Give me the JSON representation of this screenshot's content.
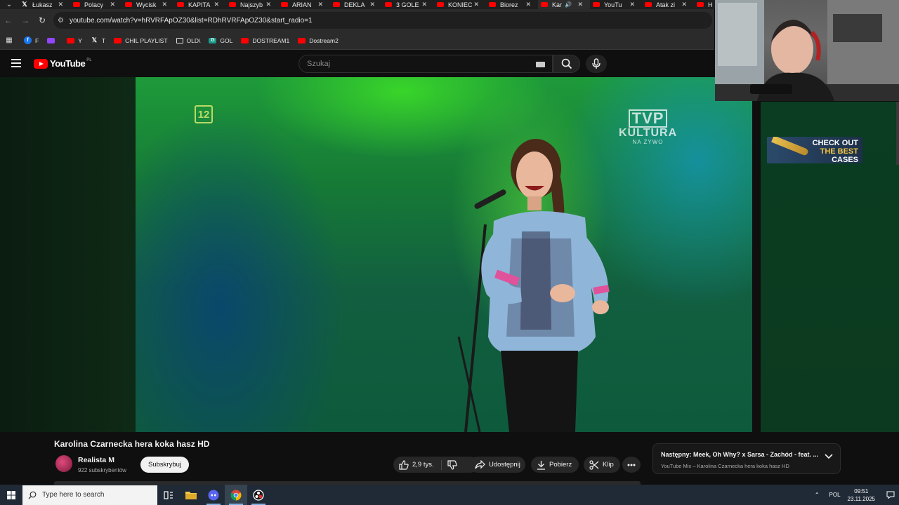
{
  "browser": {
    "tabs": [
      {
        "label": "Łukasz",
        "icon": "x-icon"
      },
      {
        "label": "Polacy",
        "icon": "youtube-icon"
      },
      {
        "label": "Wycisk",
        "icon": "youtube-icon"
      },
      {
        "label": "KAPITA",
        "icon": "youtube-icon"
      },
      {
        "label": "Najszyb",
        "icon": "youtube-icon"
      },
      {
        "label": "ARIAN",
        "icon": "youtube-icon"
      },
      {
        "label": "DEKLA",
        "icon": "youtube-icon"
      },
      {
        "label": "3 GOLE",
        "icon": "youtube-icon"
      },
      {
        "label": "KONIEC",
        "icon": "youtube-icon"
      },
      {
        "label": "Biorez",
        "icon": "youtube-icon"
      },
      {
        "label": "Kar",
        "icon": "youtube-icon",
        "active": true,
        "audio": true
      },
      {
        "label": "YouTu",
        "icon": "youtube-icon"
      },
      {
        "label": "Atak zi",
        "icon": "youtube-icon"
      },
      {
        "label": "H",
        "icon": "youtube-icon"
      }
    ],
    "url": "youtube.com/watch?v=hRVRFApOZ30&list=RDhRVRFApOZ30&start_radio=1",
    "bookmarks": [
      {
        "label": "F",
        "icon": "facebook-icon"
      },
      {
        "label": "",
        "icon": "twitch-icon"
      },
      {
        "label": "Y",
        "icon": "youtube-icon"
      },
      {
        "label": "T",
        "icon": "x-icon"
      },
      {
        "label": "CHIL PLAYLIST",
        "icon": "youtube-icon"
      },
      {
        "label": "OLD\\",
        "icon": "folder-icon"
      },
      {
        "label": "GOL",
        "icon": "g-icon"
      },
      {
        "label": "DOSTREAM1",
        "icon": "youtube-icon"
      },
      {
        "label": "Dostream2",
        "icon": "youtube-icon"
      }
    ]
  },
  "youtube": {
    "logo_text": "YouTube",
    "country_code": "PL",
    "search_placeholder": "Szukaj"
  },
  "video": {
    "overlay_channel_number": "12",
    "broadcaster_logo": "TVP",
    "broadcaster_name": "KULTURA",
    "broadcaster_live": "NA ŻYWO",
    "title": "Karolina Czarnecka hera koka hasz HD",
    "channel_name": "Realista M",
    "subscribers": "922 subskrybentów",
    "subscribe_label": "Subskrybuj",
    "likes": "2,9 tys.",
    "share_label": "Udostępnij",
    "download_label": "Pobierz",
    "clip_label": "Klip"
  },
  "ad": {
    "line1": "CHECK OUT",
    "line2": "THE BEST",
    "line3": "CASES"
  },
  "up_next": {
    "title": "Następny: Meek, Oh Why? x Sarsa - Zachód - feat. ...",
    "subtitle": "YouTube Mix – Karolina Czarnecka hera koka hasz HD"
  },
  "taskbar": {
    "search_placeholder": "Type here to search",
    "language": "POL",
    "time": "09:51",
    "date": "23.11.2025"
  },
  "colors": {
    "youtube_red": "#ff0000",
    "stage_green": "#1e9a3a",
    "page_bg": "#0f0f0f"
  }
}
